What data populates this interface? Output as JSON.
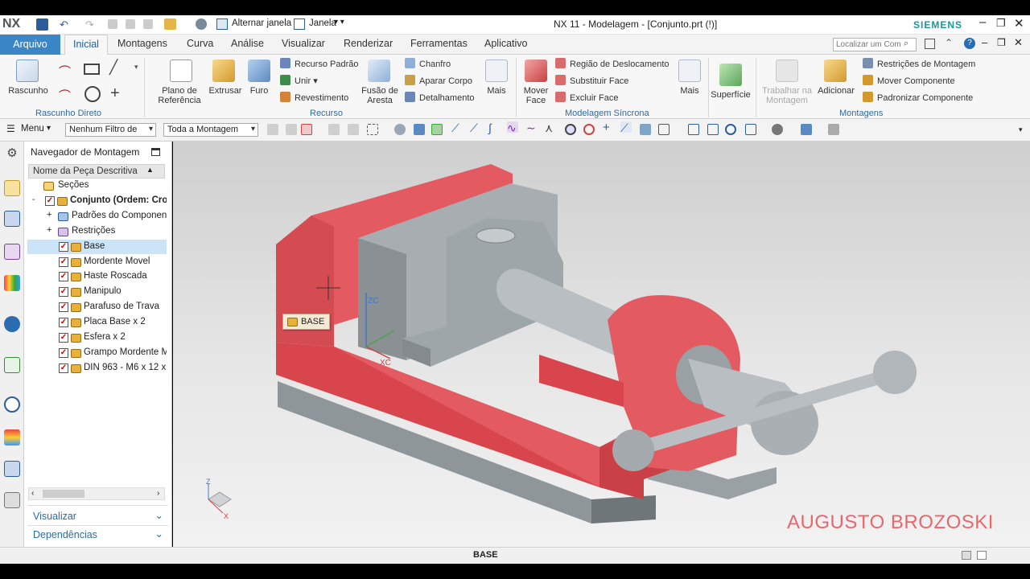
{
  "window": {
    "nx_logo": "NX",
    "title": "NX 11 - Modelagem - [Conjunto.prt  (!)]",
    "brand": "SIEMENS",
    "quick_access": {
      "alternar": "Alternar janela",
      "janela": "Janela"
    }
  },
  "tabs": {
    "file": "Arquivo",
    "items": [
      "Inicial",
      "Montagens",
      "Curva",
      "Análise",
      "Visualizar",
      "Renderizar",
      "Ferramentas",
      "Aplicativo"
    ],
    "active": "Inicial",
    "search_placeholder": "Localizar um Com"
  },
  "ribbon": {
    "rascunho": {
      "label": "Rascunho",
      "group": "Rascunho Direto"
    },
    "plano": "Plano de Referência",
    "extrusar": "Extrusar",
    "furo": "Furo",
    "recurso_padrao": "Recurso Padrão",
    "unir": "Unir",
    "revestimento": "Revestimento",
    "fusao": "Fusão de Aresta",
    "chanfro": "Chanfro",
    "aparar": "Aparar Corpo",
    "detalhamento": "Detalhamento",
    "mais1": "Mais",
    "recurso_group": "Recurso",
    "mover_face": "Mover Face",
    "regiao": "Região de Deslocamento",
    "substituir": "Substituir Face",
    "excluir": "Excluir Face",
    "mais2": "Mais",
    "sincrona_group": "Modelagem Síncrona",
    "superficie": "Superfície",
    "trabalhar": "Trabalhar na Montagem",
    "adicionar": "Adicionar",
    "restricoes": "Restrições de Montagem",
    "mover_comp": "Mover Componente",
    "padronizar": "Padronizar Componente",
    "montagens_group": "Montagens"
  },
  "filterbar": {
    "menu": "Menu",
    "filter": "Nenhum Filtro de",
    "scope": "Toda a Montagem"
  },
  "navigator": {
    "title": "Navegador de Montagem",
    "column": "Nome da Peça Descritiva",
    "nodes": [
      {
        "label": "Seções"
      },
      {
        "label": "Conjunto (Ordem: Cron"
      },
      {
        "label": "Padrões do Componen"
      },
      {
        "label": "Restrições"
      },
      {
        "label": "Base"
      },
      {
        "label": "Mordente Movel"
      },
      {
        "label": "Haste Roscada"
      },
      {
        "label": "Manipulo"
      },
      {
        "label": "Parafuso de Trava"
      },
      {
        "label": "Placa Base x 2"
      },
      {
        "label": "Esfera x 2"
      },
      {
        "label": "Grampo Mordente M"
      },
      {
        "label": "DIN 963 - M6 x 12 x 6"
      }
    ],
    "visualizar": "Visualizar",
    "dependencias": "Dependências"
  },
  "viewport": {
    "tooltip": "BASE",
    "watermark": "AUGUSTO BROZOSKI",
    "triad": {
      "z": "Z",
      "x": "X"
    },
    "csys": {
      "zc": "ZC",
      "xc": "XC"
    }
  },
  "status": {
    "text": "BASE"
  },
  "colors": {
    "accent": "#3b86c6",
    "highlight": "#e8525a",
    "part_gray": "#a3a9ad",
    "brand": "#159a9c"
  }
}
